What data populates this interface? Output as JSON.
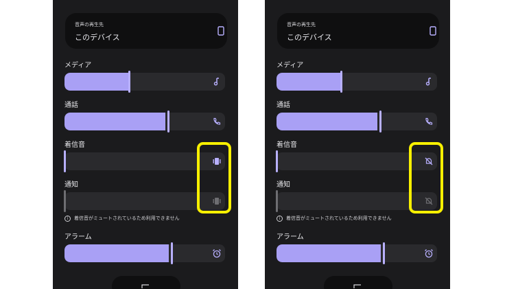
{
  "output": {
    "caption": "音声の再生先",
    "device": "このデバイス",
    "icon": "phone-icon"
  },
  "streams": [
    {
      "label": "メディア",
      "level": 0.4,
      "icon": "music-note-icon"
    },
    {
      "label": "通話",
      "level": 0.65,
      "icon": "phone-call-icon"
    },
    {
      "label": "着信音",
      "level": 0.0,
      "icon_left": "vibrate-icon",
      "icon_right": "ringer-muted-icon"
    },
    {
      "label": "通知",
      "level": 0.0,
      "icon_left": "vibrate-icon",
      "icon_right": "ringer-muted-icon"
    },
    {
      "label": "アラーム",
      "level": 0.67,
      "icon": "alarm-icon"
    }
  ],
  "note": "着信音がミュートされているため利用できません",
  "colors": {
    "accent": "#a9a0f5",
    "highlight": "#f8f000",
    "background": "#1b1b1d"
  }
}
